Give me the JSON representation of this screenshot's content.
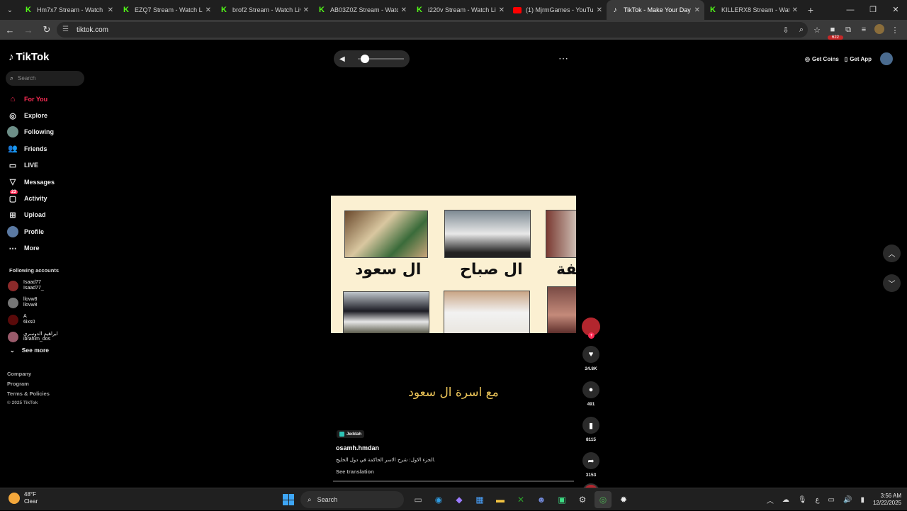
{
  "browser": {
    "tabs": [
      {
        "title": "Hm7x7 Stream - Watch Live",
        "favicon": "kick-icon"
      },
      {
        "title": "EZQ7 Stream - Watch Live",
        "favicon": "kick-icon"
      },
      {
        "title": "brof2 Stream - Watch Live",
        "favicon": "kick-icon"
      },
      {
        "title": "AB03Z0Z Stream - Watch",
        "favicon": "kick-icon"
      },
      {
        "title": "i220v Stream - Watch Live",
        "favicon": "kick-icon"
      },
      {
        "title": "(1) MjrmGames - YouTube",
        "favicon": "youtube-icon"
      },
      {
        "title": "TikTok - Make Your Day",
        "favicon": "tiktok-icon",
        "active": true
      },
      {
        "title": "KILLERX8 Stream - Watch",
        "favicon": "kick-icon"
      }
    ],
    "url": "tiktok.com",
    "extension_badge": "622"
  },
  "tiktok": {
    "logo": "TikTok",
    "search_placeholder": "Search",
    "nav": [
      {
        "label": "For You",
        "icon": "home-icon"
      },
      {
        "label": "Explore",
        "icon": "compass-icon"
      },
      {
        "label": "Following",
        "icon": "following-avatar-icon"
      },
      {
        "label": "Friends",
        "icon": "friends-icon"
      },
      {
        "label": "LIVE",
        "icon": "live-icon"
      },
      {
        "label": "Messages",
        "icon": "messages-icon"
      },
      {
        "label": "Activity",
        "icon": "activity-icon",
        "badge": "23"
      },
      {
        "label": "Upload",
        "icon": "upload-icon"
      },
      {
        "label": "Profile",
        "icon": "profile-icon"
      },
      {
        "label": "More",
        "icon": "more-icon"
      }
    ],
    "following_title": "Following accounts",
    "following": [
      {
        "name": "Isaad77",
        "handle": "Isaad77_"
      },
      {
        "name": "llovw8",
        "handle": "llovw8"
      },
      {
        "name": "A",
        "handle": "6ixs0"
      },
      {
        "name": "ابراهيم الدوسري",
        "handle": "ibrahim_dos"
      }
    ],
    "see_more": "See more",
    "footer": [
      "Company",
      "Program",
      "Terms & Policies"
    ],
    "copyright": "© 2025 TikTok",
    "top_right": {
      "coins": "Get Coins",
      "app": "Get App"
    },
    "volume_level": 0.15,
    "video": {
      "captions": [
        "ال سعود",
        "ال صباح",
        "يفة"
      ],
      "subtitle": "مع اسرة ال سعود",
      "location": "Jeddah",
      "author": "osamh.hmdan",
      "description": "الجزء الاول: شرح الاسر الحاكمة في دول الخليج.",
      "see_translation": "See translation"
    },
    "actions": {
      "likes": "24.8K",
      "comments": "491",
      "saves": "8115",
      "shares": "3153"
    }
  },
  "taskbar": {
    "temp": "48°F",
    "condition": "Clear",
    "search": "Search",
    "time": "3:56 AM",
    "date": "12/22/2025",
    "lang": "ع"
  }
}
